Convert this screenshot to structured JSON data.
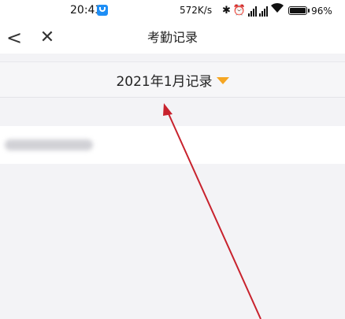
{
  "status_bar": {
    "time": "20:43",
    "network_speed": "572K/s",
    "battery_percent": "96%"
  },
  "nav": {
    "title": "考勤记录",
    "back_glyph": "<",
    "close_glyph": "✕"
  },
  "month_selector": {
    "label": "2021年1月记录"
  },
  "colors": {
    "accent_caret": "#f5a623",
    "annotation_arrow": "#c8222d"
  },
  "icons": [
    "bluetooth-icon",
    "alarm-icon",
    "signal-icon",
    "wifi-icon",
    "battery-icon",
    "back-icon",
    "close-icon",
    "dropdown-caret-icon"
  ]
}
